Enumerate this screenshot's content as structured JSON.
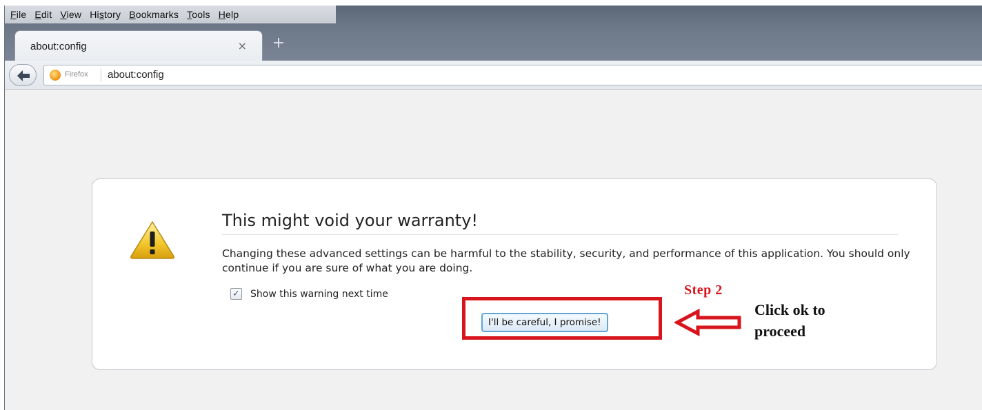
{
  "menubar": {
    "items": [
      {
        "label": "File",
        "key": "F"
      },
      {
        "label": "Edit",
        "key": "E"
      },
      {
        "label": "View",
        "key": "V"
      },
      {
        "label": "History",
        "key": "s"
      },
      {
        "label": "Bookmarks",
        "key": "B"
      },
      {
        "label": "Tools",
        "key": "T"
      },
      {
        "label": "Help",
        "key": "H"
      }
    ]
  },
  "tab": {
    "title": "about:config",
    "close_glyph": "×"
  },
  "new_tab_glyph": "+",
  "navbar": {
    "identity_label": "Firefox",
    "url": "about:config"
  },
  "warning": {
    "title": "This might void your warranty!",
    "description": "Changing these advanced settings can be harmful to the stability, security, and performance of this application. You should only continue if you are sure of what you are doing.",
    "checkbox_label": "Show this warning next time",
    "checkbox_checked": true,
    "button_label": "I'll be careful, I promise!"
  },
  "annotation": {
    "step_label": "Step 2",
    "instruction_line1": "Click ok to",
    "instruction_line2": "proceed",
    "color": "#d8141c"
  },
  "icons": {
    "back": "back-arrow-icon",
    "identity": "firefox-icon",
    "warning": "warning-triangle-icon",
    "annotation_arrow": "left-arrow-icon"
  }
}
